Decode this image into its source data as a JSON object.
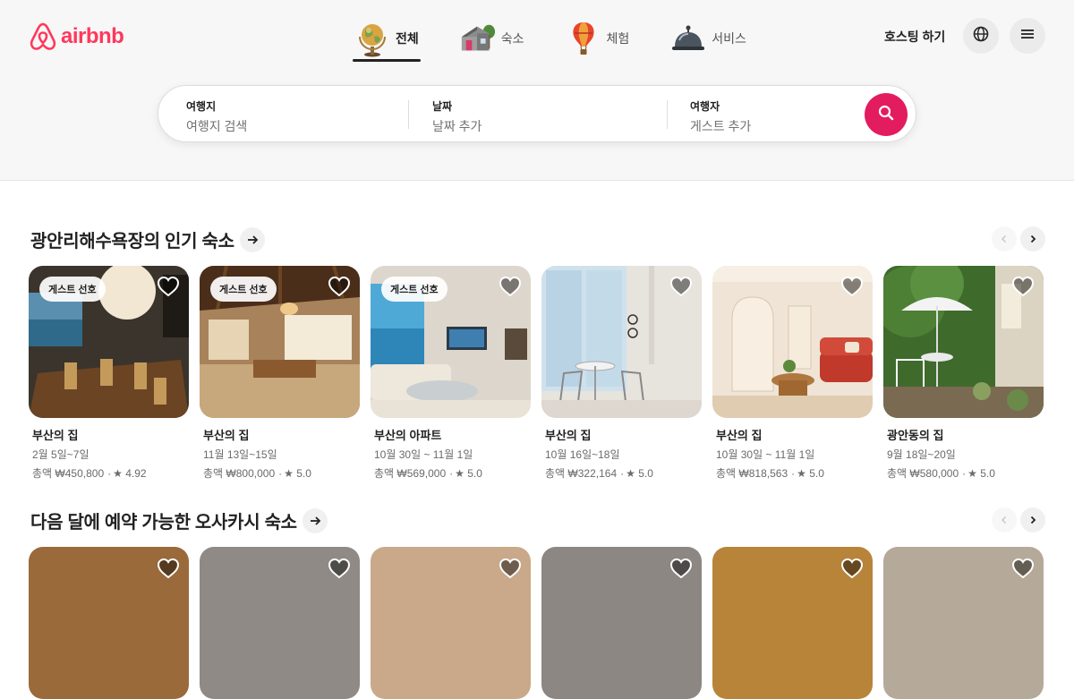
{
  "brand": {
    "name": "airbnb",
    "color": "#FF385C"
  },
  "tabs": [
    {
      "label": "전체",
      "icon": "globe-icon",
      "active": true
    },
    {
      "label": "숙소",
      "icon": "house-icon",
      "active": false
    },
    {
      "label": "체험",
      "icon": "hot-air-balloon-icon",
      "active": false
    },
    {
      "label": "서비스",
      "icon": "service-bell-icon",
      "active": false
    }
  ],
  "header": {
    "hosting_label": "호스팅 하기",
    "globe_icon": "globe-icon",
    "menu_icon": "menu-icon"
  },
  "search": {
    "where_label": "여행지",
    "where_placeholder": "여행지 검색",
    "date_label": "날짜",
    "date_placeholder": "날짜 추가",
    "guests_label": "여행자",
    "guests_placeholder": "게스트 추가",
    "button_icon": "search-icon",
    "button_color": "#E31C5F"
  },
  "sections": [
    {
      "title": "광안리해수욕장의 인기 숙소",
      "cards": [
        {
          "badge": "게스트 선호",
          "title": "부산의 집",
          "date": "2월 5일~7일",
          "price": "총액 ₩450,800",
          "rating": "★ 4.92"
        },
        {
          "badge": "게스트 선호",
          "title": "부산의 집",
          "date": "11월 13일~15일",
          "price": "총액 ₩800,000",
          "rating": "★ 5.0"
        },
        {
          "badge": "게스트 선호",
          "title": "부산의 아파트",
          "date": "10월 30일 ~ 11월 1일",
          "price": "총액 ₩569,000",
          "rating": "★ 5.0"
        },
        {
          "badge": "",
          "title": "부산의 집",
          "date": "10월 16일~18일",
          "price": "총액 ₩322,164",
          "rating": "★ 5.0"
        },
        {
          "badge": "",
          "title": "부산의 집",
          "date": "10월 30일 ~ 11월 1일",
          "price": "총액 ₩818,563",
          "rating": "★ 5.0"
        },
        {
          "badge": "",
          "title": "광안동의 집",
          "date": "9월 18일~20일",
          "price": "총액 ₩580,000",
          "rating": "★ 5.0"
        }
      ]
    },
    {
      "title": "다음 달에 예약 가능한 오사카시 숙소"
    }
  ]
}
